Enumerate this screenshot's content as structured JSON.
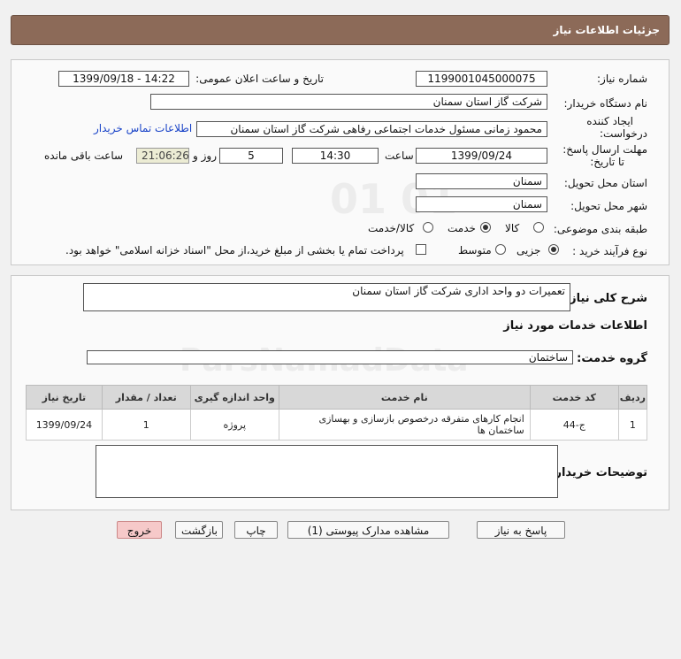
{
  "header": {
    "title": "جزئیات اطلاعات نیاز"
  },
  "form": {
    "need_number_label": "شماره نیاز:",
    "need_number": "1199001045000075",
    "announce_label": "تاریخ و ساعت اعلان عمومی:",
    "announce_value": "1399/09/18 - 14:22",
    "buyer_org_label": "نام دستگاه خریدار:",
    "buyer_org": "شرکت گاز استان سمنان",
    "requester_label_1": "ایجاد کننده",
    "requester_label_2": "درخواست:",
    "requester": "محمود زمانی مسئول خدمات اجتماعی رفاهی شرکت گاز استان سمنان",
    "contact_link": "اطلاعات تماس خریدار",
    "deadline_label_1": "مهلت ارسال پاسخ:",
    "deadline_label_2": "تا تاریخ:",
    "deadline_date": "1399/09/24",
    "time_label": "ساعت",
    "deadline_time": "14:30",
    "days_value": "5",
    "days_label": "روز و",
    "remaining_time": "21:06:26",
    "remaining_label": "ساعت باقی مانده",
    "province_label": "استان محل تحویل:",
    "province": "سمنان",
    "city_label": "شهر محل تحویل:",
    "city": "سمنان",
    "category_label": "طبقه بندی موضوعی:",
    "category_options": [
      "کالا",
      "خدمت",
      "کالا/خدمت"
    ],
    "category_selected": "خدمت",
    "process_label": "نوع فرآیند خرید :",
    "process_options": [
      "جزیی",
      "متوسط"
    ],
    "process_selected": "جزیی",
    "payment_note": "پرداخت تمام یا بخشی از مبلغ خرید،از محل \"اسناد خزانه اسلامی\" خواهد بود."
  },
  "summary": {
    "label": "شرح کلی نیاز:",
    "value": "تعمیرات دو واحد اداری شرکت گاز استان سمنان",
    "services_heading": "اطلاعات خدمات مورد نیاز",
    "service_group_label": "گروه خدمت:",
    "service_group": "ساختمان"
  },
  "table": {
    "headers": [
      "ردیف",
      "کد خدمت",
      "نام خدمت",
      "واحد اندازه گیری",
      "تعداد / مقدار",
      "تاریخ نیاز"
    ],
    "rows": [
      [
        "1",
        "ج-44",
        "انجام کارهای متفرقه درخصوص بازسازی و بهسازی ساختمان ها",
        "پروژه",
        "1",
        "1399/09/24"
      ]
    ]
  },
  "buyer_notes_label": "توضیحات خریدار:",
  "buttons": {
    "reply": "پاسخ به نیاز",
    "attachments": "مشاهده مدارک پیوستی (1)",
    "print": "چاپ",
    "back": "بازگشت",
    "exit": "خروج"
  }
}
